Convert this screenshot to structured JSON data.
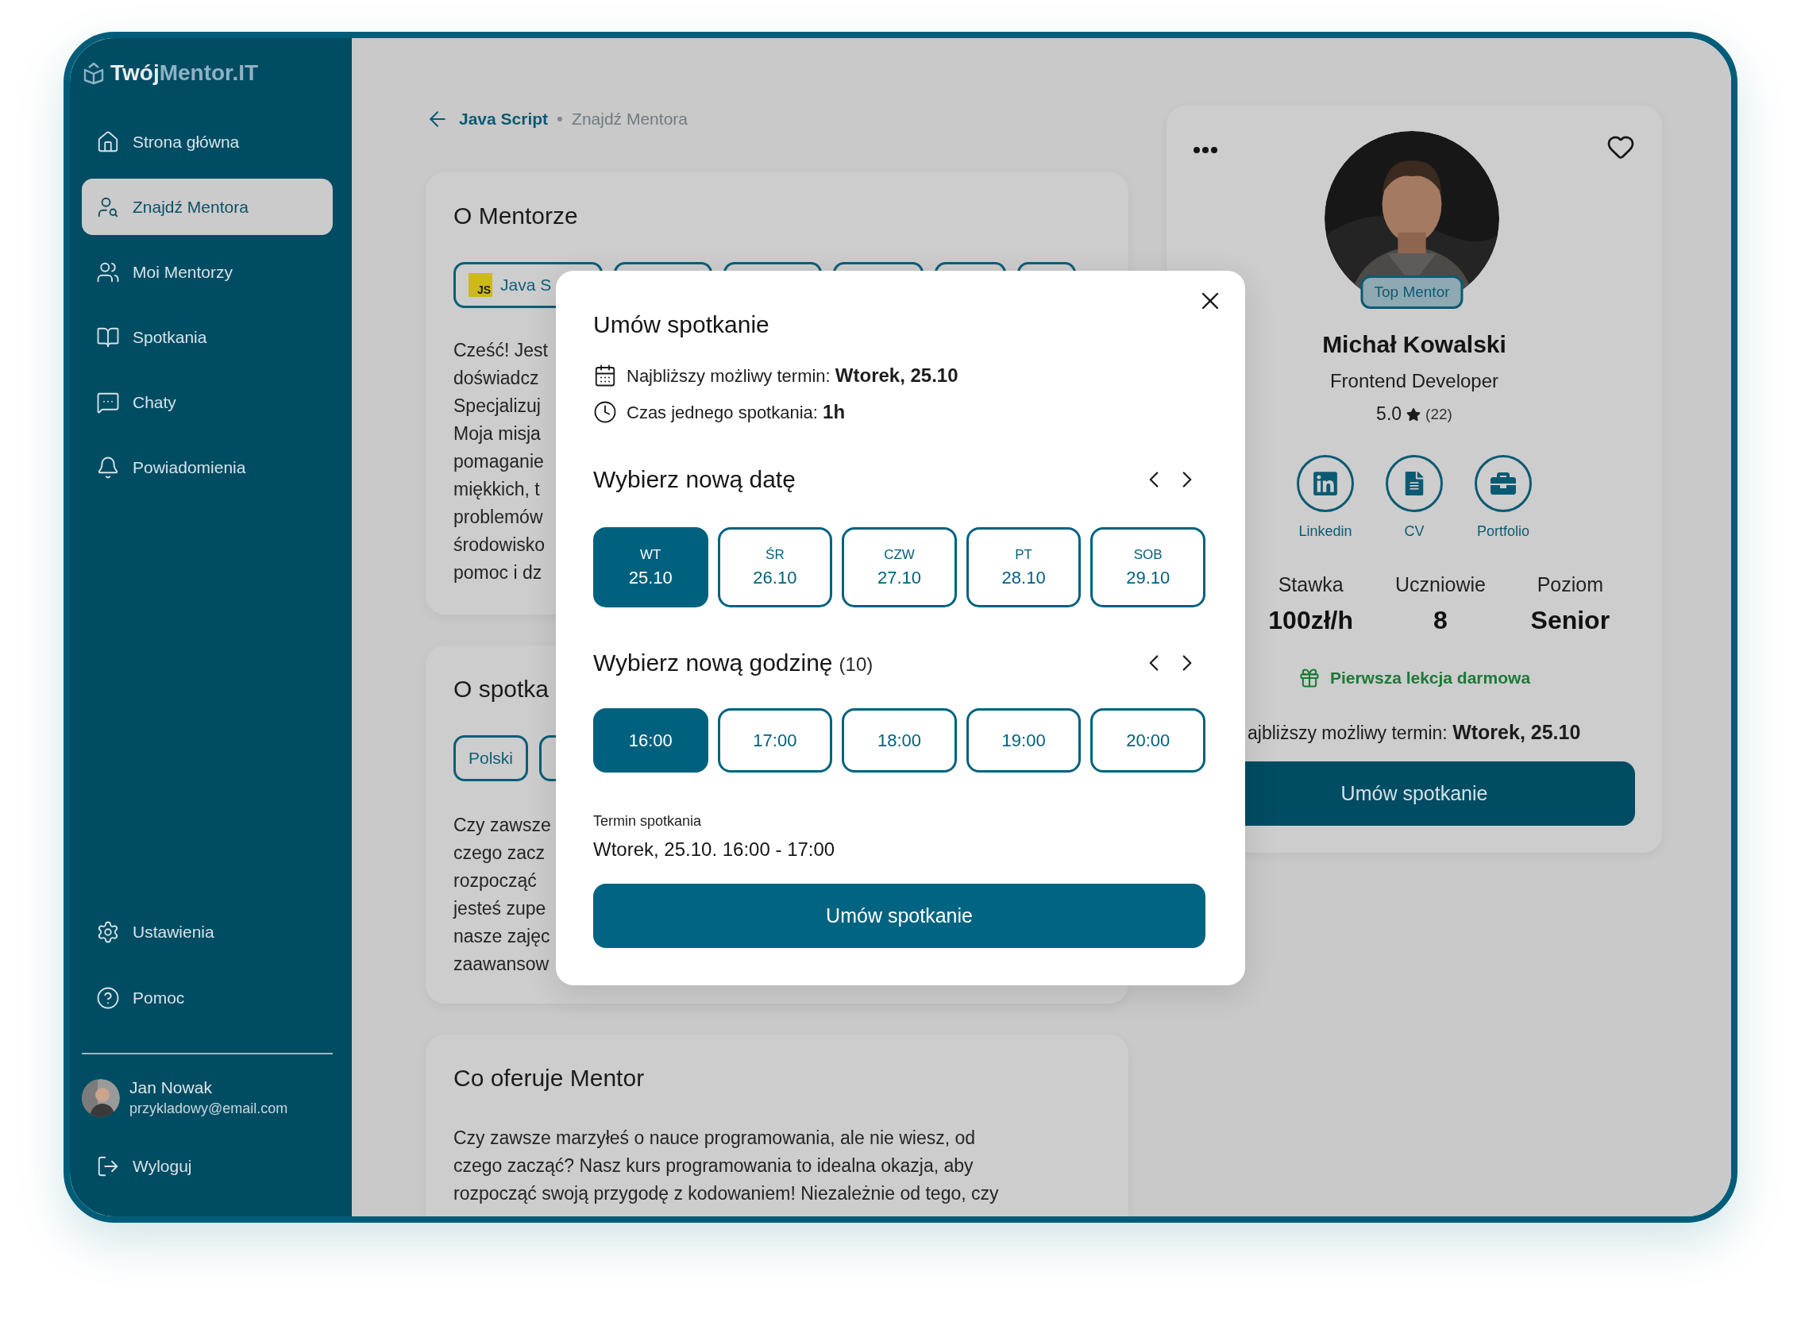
{
  "logo": {
    "primary": "Twój",
    "secondary": "Mentor.IT"
  },
  "sidebar": {
    "items": [
      {
        "label": "Strona główna",
        "selected": false
      },
      {
        "label": "Znajdź Mentora",
        "selected": true
      },
      {
        "label": "Moi Mentorzy",
        "selected": false
      },
      {
        "label": "Spotkania",
        "selected": false
      },
      {
        "label": "Chaty",
        "selected": false
      },
      {
        "label": "Powiadomienia",
        "selected": false
      }
    ],
    "bottom_items": [
      "Ustawienia",
      "Pomoc"
    ],
    "user": {
      "name": "Jan Nowak",
      "email": "przykladowy@email.com"
    },
    "logout": "Wyloguj"
  },
  "breadcrumb": {
    "link": "Java Script",
    "current": "Znajdź Mentora"
  },
  "about": {
    "title": "O Mentorze",
    "tags": [
      {
        "kind": "language",
        "badge": "JS",
        "label": "Java S"
      },
      {
        "kind": "covered"
      },
      {
        "kind": "covered"
      },
      {
        "kind": "covered"
      },
      {
        "kind": "covered"
      },
      {
        "kind": "covered"
      }
    ],
    "paragraph": [
      "Cześć! Jest",
      "doświadcz",
      "Specjalizuj",
      "Moja misja",
      "pomaganie",
      "miękkich, t",
      "problemów",
      "środowisko",
      "pomoc i dz"
    ]
  },
  "meeting": {
    "title": "O spotka",
    "tags": [
      {
        "kind": "plain",
        "label": "Polski"
      },
      {
        "kind": "covered"
      }
    ],
    "paragraph": [
      "Czy zawsze",
      "czego zacz",
      "rozpocząć",
      "jesteś zupe",
      "nasze zajęc",
      "zaawansow"
    ]
  },
  "offer": {
    "title": "Co oferuje Mentor",
    "paragraph": [
      "Czy zawsze marzyłeś o nauce programowania, ale nie wiesz, od",
      "czego zacząć? Nasz kurs programowania to idealna okazja, aby",
      "rozpocząć swoją przygodę z kodowaniem! Niezależnie od tego, czy"
    ]
  },
  "mentor_card": {
    "badge": "Top Mentor",
    "name": "Michał Kowalski",
    "role": "Frontend Developer",
    "rating": "5.0",
    "reviews": "(22)",
    "links": [
      {
        "kind": "linkedin",
        "label": "Linkedin"
      },
      {
        "kind": "cv",
        "label": "CV"
      },
      {
        "kind": "portfolio",
        "label": "Portfolio"
      }
    ],
    "stats": [
      {
        "label": "Stawka",
        "value": "100zł/h"
      },
      {
        "label": "Uczniowie",
        "value": "8"
      },
      {
        "label": "Poziom",
        "value": "Senior"
      }
    ],
    "promo": "Pierwsza lekcja darmowa",
    "next_term": "ajbliższy możliwy termin: **Wtorek, 25.10**",
    "button": "Umów spotkanie"
  },
  "modal": {
    "title": "Umów spotkanie",
    "info": [
      {
        "kind": "calendar",
        "text": "Najbliższy możliwy termin: **Wtorek, 25.10**"
      },
      {
        "kind": "clock",
        "text": "Czas jednego spotkania: **1h**"
      }
    ],
    "date_section": {
      "title": "Wybierz nową datę",
      "dates": [
        {
          "day": "WT",
          "date": "25.10",
          "selected": true
        },
        {
          "day": "ŚR",
          "date": "26.10",
          "selected": false
        },
        {
          "day": "CZW",
          "date": "27.10",
          "selected": false
        },
        {
          "day": "PT",
          "date": "28.10",
          "selected": false
        },
        {
          "day": "SOB",
          "date": "29.10",
          "selected": false
        }
      ]
    },
    "time_section": {
      "title": "Wybierz nową godzinę",
      "count": "(10)",
      "times": [
        {
          "label": "16:00",
          "selected": true
        },
        {
          "label": "17:00",
          "selected": false
        },
        {
          "label": "18:00",
          "selected": false
        },
        {
          "label": "19:00",
          "selected": false
        },
        {
          "label": "20:00",
          "selected": false
        }
      ]
    },
    "summary_label": "Termin spotkania",
    "summary_value": "Wtorek, 25.10. 16:00 - 17:00",
    "button": "Umów spotkanie"
  }
}
